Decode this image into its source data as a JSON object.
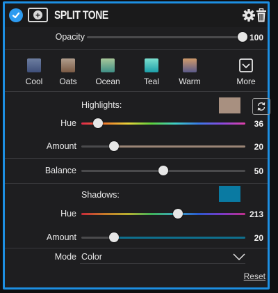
{
  "header": {
    "title": "SPLIT TONE",
    "enabled_checked": true
  },
  "opacity": {
    "label": "Opacity",
    "value": "100",
    "level": 1.0
  },
  "presets": [
    {
      "name": "Cool",
      "icon": "cool-swatch"
    },
    {
      "name": "Oats",
      "icon": "oats-swatch"
    },
    {
      "name": "Ocean",
      "icon": "ocean-swatch"
    },
    {
      "name": "Teal",
      "icon": "teal-swatch"
    },
    {
      "name": "Warm",
      "icon": "warm-swatch"
    },
    {
      "name": "More",
      "icon": "chevron-down-box-icon"
    }
  ],
  "highlights": {
    "label": "Highlights:",
    "color": "#a89080",
    "hue": {
      "label": "Hue",
      "value": "36",
      "level": 0.1
    },
    "amount": {
      "label": "Amount",
      "value": "20",
      "level": 0.2
    }
  },
  "balance": {
    "label": "Balance",
    "value": "50",
    "level": 0.5
  },
  "shadows": {
    "label": "Shadows:",
    "color": "#0a7aa2",
    "hue": {
      "label": "Hue",
      "value": "213",
      "level": 0.59
    },
    "amount": {
      "label": "Amount",
      "value": "20",
      "level": 0.2
    }
  },
  "mode": {
    "label": "Mode",
    "selected": "Color"
  },
  "reset_label": "Reset",
  "colors": {
    "accent": "#1d8fe2",
    "panel_bg": "#1e1e20",
    "highlight_amount_track": "#9a8576",
    "shadow_amount_track": "#0f6f8d"
  }
}
